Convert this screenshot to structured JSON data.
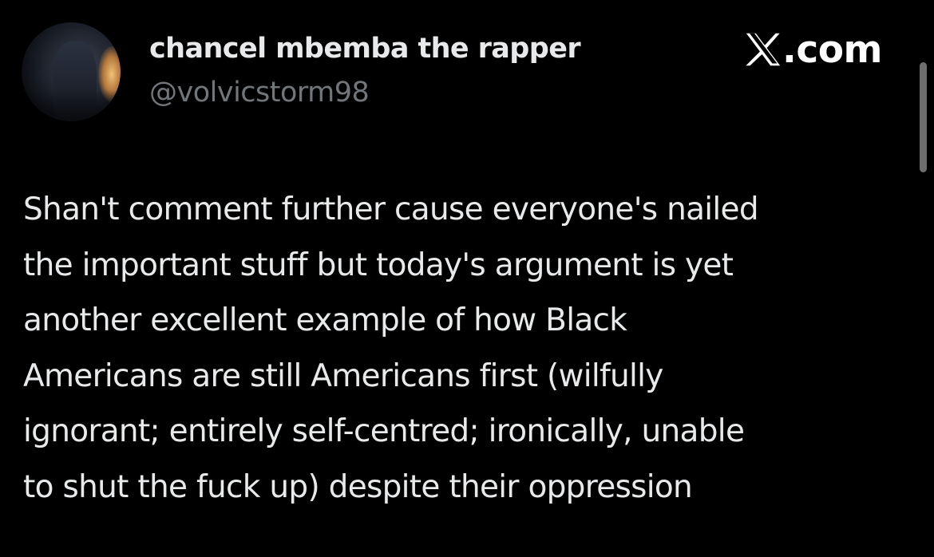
{
  "tweet": {
    "author": {
      "display_name": "chancel mbemba the rapper",
      "handle": "@volvicstorm98",
      "avatar": "profile-photo-avatar"
    },
    "brand": {
      "icon": "x-logo-icon",
      "text": ".com"
    },
    "body_lines": [
      "Shan't comment further cause everyone's nailed",
      "the important stuff but today's argument is yet",
      "another excellent example of how Black",
      "Americans are still Americans first (wilfully",
      "ignorant; entirely self-centred; ironically, unable",
      "to shut the fuck up) despite their oppression"
    ]
  },
  "colors": {
    "background": "#000000",
    "primary_text": "#e7e9ea",
    "secondary_text": "#71767b",
    "scrollbar": "#6e6e6e"
  }
}
